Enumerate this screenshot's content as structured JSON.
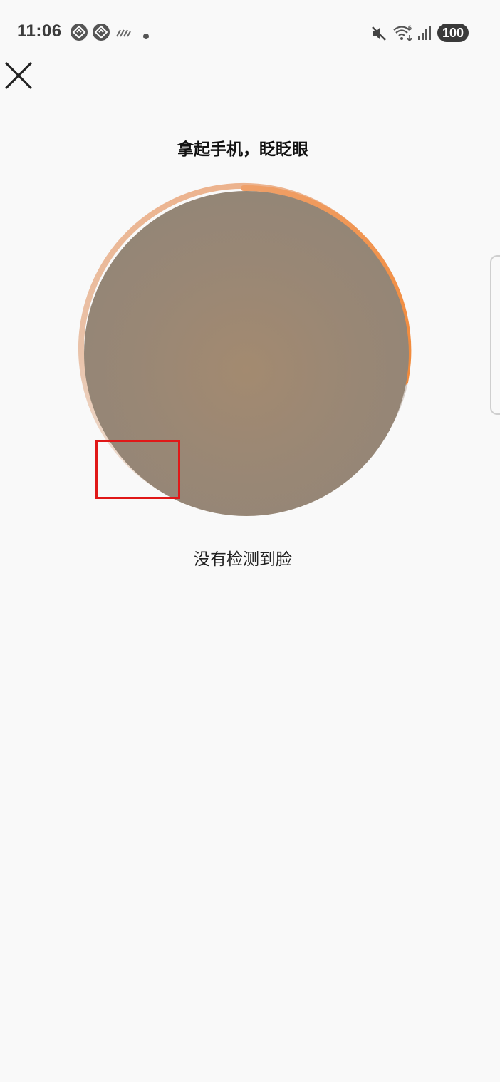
{
  "status_bar": {
    "time": "11:06",
    "battery": "100",
    "icons": [
      "app-notification-icon",
      "app-notification-icon",
      "sync-stripes-icon",
      "dot-icon",
      "mute-icon",
      "wifi-6-icon",
      "cellular-signal-icon",
      "battery-icon"
    ]
  },
  "nav": {
    "close_icon": "close-icon"
  },
  "prompt": {
    "title": "拿起手机，眨眨眼"
  },
  "face_capture": {
    "status": "没有检测到脸",
    "progress": 0.25,
    "colors": {
      "progress": "#f39a52",
      "track": "#d6cec8",
      "face_preview": "#9a8775",
      "highlight": "#e01818"
    }
  }
}
